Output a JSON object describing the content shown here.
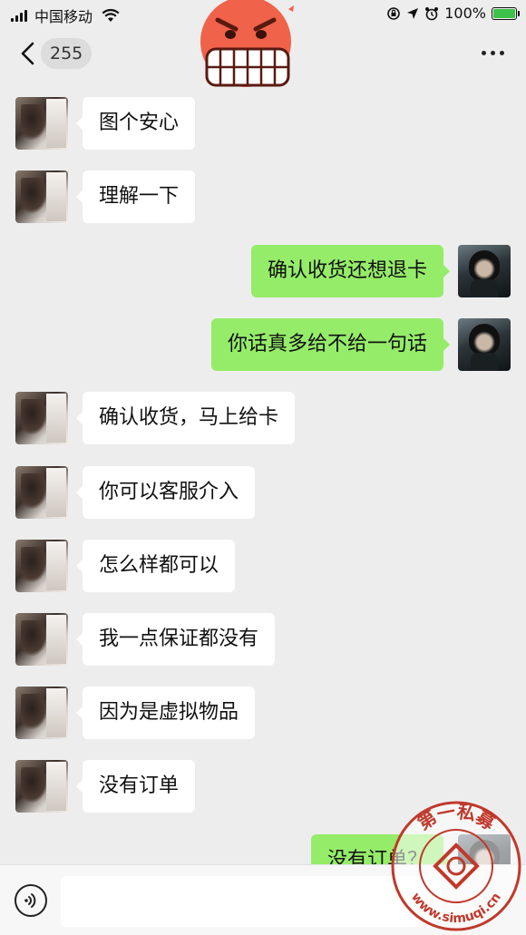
{
  "status_bar": {
    "carrier": "中国移动",
    "battery_percent": "100%",
    "battery_level": 1.0
  },
  "nav": {
    "unread_count": "255"
  },
  "messages": [
    {
      "side": "left",
      "text": "图个安心"
    },
    {
      "side": "left",
      "text": "理解一下"
    },
    {
      "side": "right",
      "text": "确认收货还想退卡"
    },
    {
      "side": "right",
      "text": "你话真多给不给一句话"
    },
    {
      "side": "left",
      "text": "确认收货，马上给卡"
    },
    {
      "side": "left",
      "text": "你可以客服介入"
    },
    {
      "side": "left",
      "text": "怎么样都可以"
    },
    {
      "side": "left",
      "text": "我一点保证都没有"
    },
    {
      "side": "left",
      "text": "因为是虚拟物品"
    },
    {
      "side": "left",
      "text": "没有订单"
    },
    {
      "side": "right",
      "text": "没有订单？"
    }
  ],
  "input": {
    "placeholder": ""
  },
  "watermark": {
    "text_top": "第一私募",
    "text_bottom": "www.simuqi.cn"
  },
  "colors": {
    "background": "#ededed",
    "bubble_self": "#95ec69",
    "bubble_other": "#ffffff",
    "emoji_face": "#f0624a",
    "watermark_red": "#c0392b"
  },
  "icons": {
    "back": "chevron-left-icon",
    "more": "more-dots-icon",
    "voice": "voice-icon",
    "emoji": "angry-grimace-emoji",
    "wifi": "wifi-icon",
    "signal": "signal-icon",
    "battery": "battery-icon"
  }
}
